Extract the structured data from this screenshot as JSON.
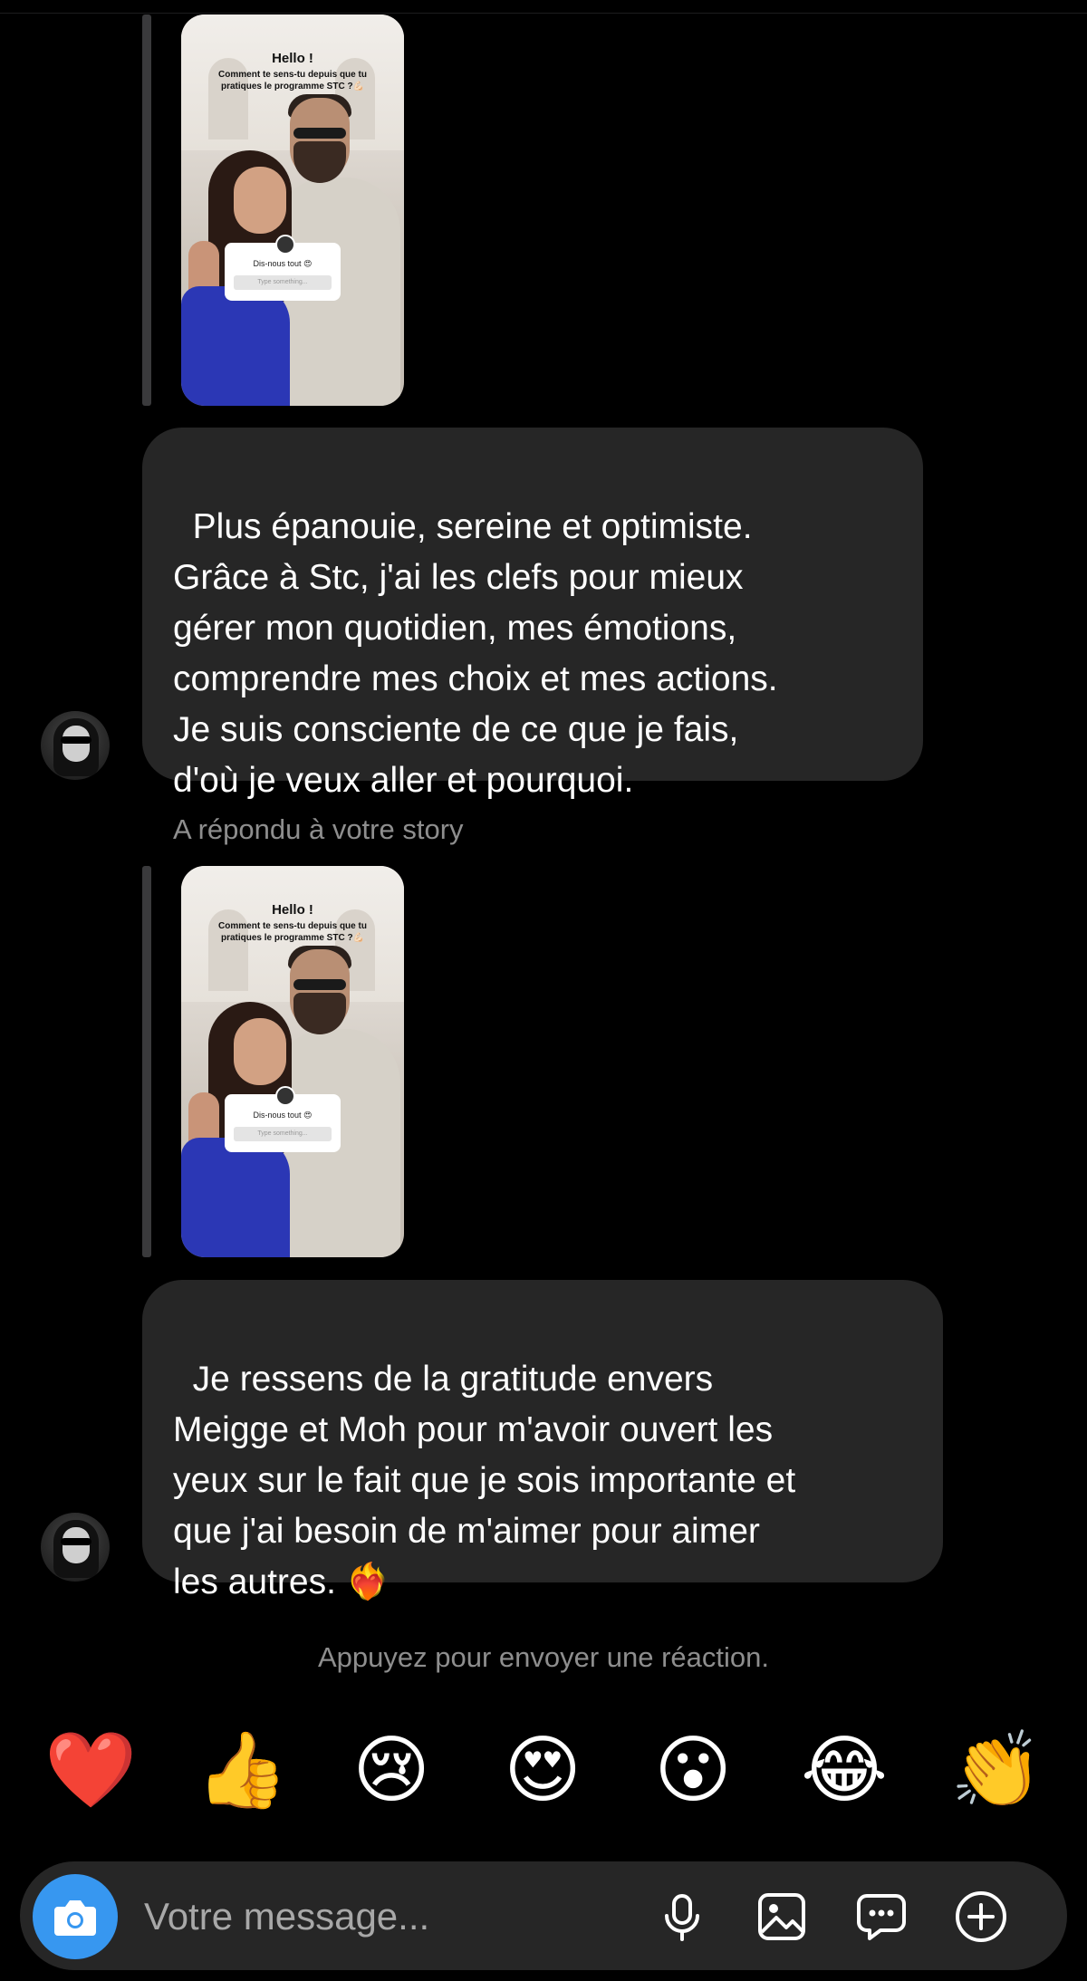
{
  "thread": {
    "messages": [
      {
        "story_text": {
          "hello": "Hello !",
          "question": "Comment te sens-tu depuis que tu pratiques le programme STC ?💪🏻",
          "sticker_title": "Dis-nous tout 😍",
          "sticker_input": "Type something..."
        },
        "text": "Plus épanouie, sereine et optimiste.\nGrâce à Stc, j'ai les clefs pour mieux\ngérer mon quotidien, mes émotions,\ncomprendre mes choix et mes actions.\nJe suis consciente de ce que je fais,\nd'où je veux aller et pourquoi."
      },
      {
        "reply_label": "A répondu à votre story",
        "story_text": {
          "hello": "Hello !",
          "question": "Comment te sens-tu depuis que tu pratiques le programme STC ?💪🏻",
          "sticker_title": "Dis-nous tout 😍",
          "sticker_input": "Type something..."
        },
        "text": "Je ressens de la gratitude envers\nMeigge et Moh pour m'avoir ouvert les\nyeux sur le fait que je sois importante et\nque j'ai besoin de m'aimer pour aimer\nles autres. ❤️‍🔥"
      }
    ]
  },
  "reaction_hint": "Appuyez pour envoyer une réaction.",
  "reactions": [
    "❤️",
    "👍",
    "😢",
    "😍",
    "😮",
    "😂",
    "👏"
  ],
  "composer": {
    "placeholder": "Votre message...",
    "icons": [
      "camera-icon",
      "microphone-icon",
      "gallery-icon",
      "sticker-chat-icon",
      "add-icon"
    ],
    "camera_color": "#3797f0"
  }
}
